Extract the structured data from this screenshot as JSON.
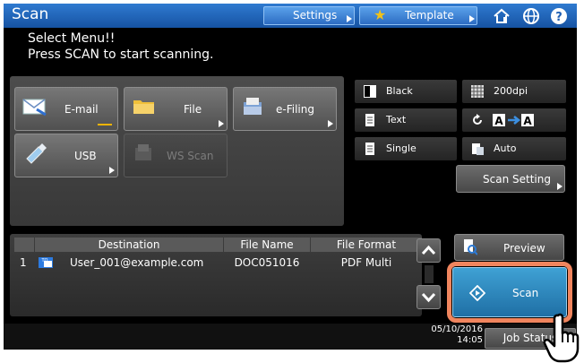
{
  "title": "Scan",
  "header": {
    "settings_label": "Settings",
    "template_label": "Template",
    "home_icon": "home-icon",
    "globe_icon": "globe-icon",
    "help_icon": "help-icon"
  },
  "message": {
    "line1": "Select Menu!!",
    "line2": "Press SCAN to start scanning."
  },
  "functions": [
    {
      "label": "E-mail",
      "icon": "email-icon",
      "selected": true
    },
    {
      "label": "File",
      "icon": "folder-icon"
    },
    {
      "label": "e-Filing",
      "icon": "efiling-icon"
    },
    {
      "label": "USB",
      "icon": "usb-icon"
    },
    {
      "label": "WS Scan",
      "icon": "ws-scan-icon",
      "disabled": true
    }
  ],
  "options": {
    "color": "Black",
    "resolution": "200dpi",
    "original_mode": "Text",
    "rotation_icon": "rotate-icon",
    "paper_sides": "Single",
    "paper_size": "Auto",
    "scan_setting_label": "Scan Setting"
  },
  "table": {
    "headers": [
      "Destination",
      "File Name",
      "File Format"
    ],
    "rows": [
      {
        "num": "1",
        "destination": "User_001@example.com",
        "file_name": "DOC051016",
        "file_format": "PDF Multi"
      }
    ]
  },
  "actions": {
    "preview_label": "Preview",
    "scan_label": "Scan"
  },
  "footer": {
    "date": "05/10/2016",
    "time": "14:05",
    "job_status_label": "Job Status"
  },
  "colors": {
    "title_bar": "#1f63b8",
    "scan_button": "#2a86bf",
    "highlight": "#f0855e",
    "email_underline": "#f1b400"
  }
}
